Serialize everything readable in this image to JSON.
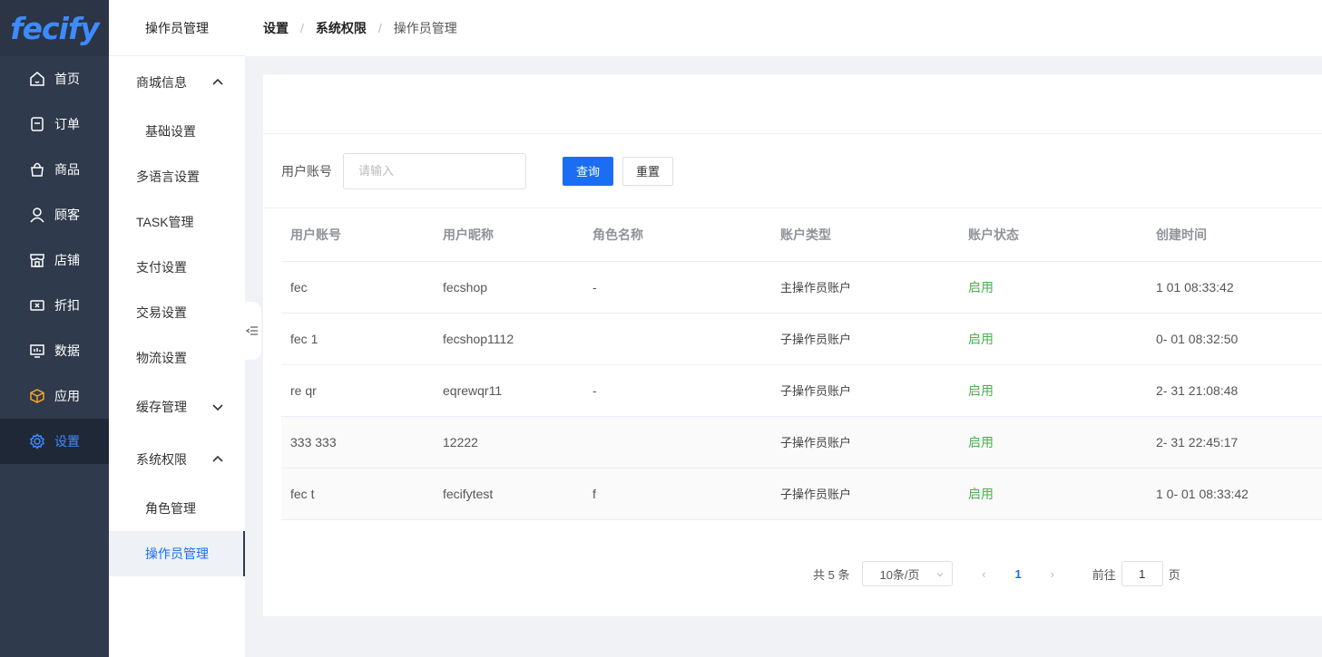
{
  "brand": {
    "logo_text": "fecify",
    "accent": "#3d8bfd"
  },
  "nav": {
    "items": [
      {
        "label": "首页",
        "icon": "home-icon"
      },
      {
        "label": "订单",
        "icon": "order-icon"
      },
      {
        "label": "商品",
        "icon": "bag-icon"
      },
      {
        "label": "顾客",
        "icon": "user-icon"
      },
      {
        "label": "店铺",
        "icon": "store-icon"
      },
      {
        "label": "折扣",
        "icon": "ticket-icon"
      },
      {
        "label": "数据",
        "icon": "chart-icon"
      },
      {
        "label": "应用",
        "icon": "cube-icon"
      },
      {
        "label": "设置",
        "icon": "gear-icon",
        "active": true
      }
    ]
  },
  "submenu": {
    "title": "操作员管理",
    "group_shop": "商城信息",
    "basic_settings": "基础设置",
    "multilang": "多语言设置",
    "task": "TASK管理",
    "payment": "支付设置",
    "trade": "交易设置",
    "logistics": "物流设置",
    "cache": "缓存管理",
    "group_perm": "系统权限",
    "role_mgmt": "角色管理",
    "operator_mgmt": "操作员管理"
  },
  "breadcrumb": {
    "c1": "设置",
    "c2": "系统权限",
    "c3": "操作员管理",
    "sep": "/"
  },
  "filter": {
    "label": "用户账号",
    "placeholder": "请输入",
    "query_label": "查询",
    "reset_label": "重置"
  },
  "table": {
    "headers": {
      "account": "用户账号",
      "nickname": "用户昵称",
      "role": "角色名称",
      "type": "账户类型",
      "status": "账户状态",
      "created": "创建时间"
    },
    "rows": [
      {
        "account": "fec",
        "nickname": "fecshop",
        "role": "-",
        "type": "主操作员账户",
        "status": "启用",
        "created": "1 01 08:33:42"
      },
      {
        "account": "fec 1",
        "nickname": "fecshop1112",
        "role": "",
        "type": "子操作员账户",
        "status": "启用",
        "created": "0- 01 08:32:50"
      },
      {
        "account": "re qr",
        "nickname": "eqrewqr11",
        "role": "-",
        "type": "子操作员账户",
        "status": "启用",
        "created": "2- 31 21:08:48"
      },
      {
        "account": "333 333",
        "nickname": "12222",
        "role": "",
        "type": "子操作员账户",
        "status": "启用",
        "created": "2- 31 22:45:17"
      },
      {
        "account": "fec t",
        "nickname": "fecifytest",
        "role": "f",
        "type": "子操作员账户",
        "status": "启用",
        "created": "1 0- 01 08:33:42"
      }
    ],
    "status_color": "#4caf50"
  },
  "pagination": {
    "total": "共 5 条",
    "page_size": "10条/页",
    "prev": "‹",
    "current": "1",
    "next": "›",
    "goto_prefix": "前往",
    "goto_value": "1",
    "goto_suffix": "页"
  }
}
